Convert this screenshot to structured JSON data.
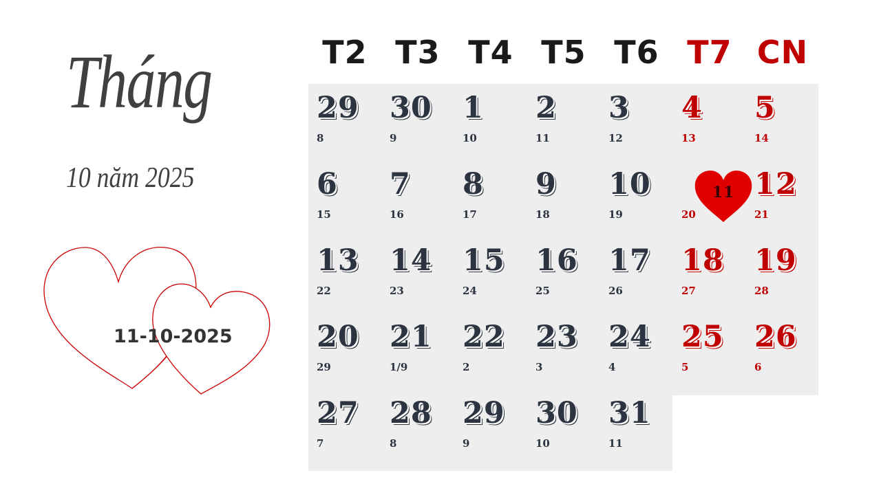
{
  "title": {
    "month_word": "Tháng",
    "month_year": "10 năm 2025"
  },
  "badge": {
    "date": "11-10-2025"
  },
  "weekdays": [
    "T2",
    "T3",
    "T4",
    "T5",
    "T6",
    "T7",
    "CN"
  ],
  "colors": {
    "accent": "#c00000",
    "text": "#2b3440",
    "cell_bg": "#eeeeee"
  },
  "days": [
    {
      "solar": "29",
      "lunar": "8"
    },
    {
      "solar": "30",
      "lunar": "9"
    },
    {
      "solar": "1",
      "lunar": "10"
    },
    {
      "solar": "2",
      "lunar": "11"
    },
    {
      "solar": "3",
      "lunar": "12"
    },
    {
      "solar": "4",
      "lunar": "13"
    },
    {
      "solar": "5",
      "lunar": "14"
    },
    {
      "solar": "6",
      "lunar": "15"
    },
    {
      "solar": "7",
      "lunar": "16"
    },
    {
      "solar": "8",
      "lunar": "17"
    },
    {
      "solar": "9",
      "lunar": "18"
    },
    {
      "solar": "10",
      "lunar": "19"
    },
    {
      "solar": "11",
      "lunar": "20",
      "highlight": "heart"
    },
    {
      "solar": "12",
      "lunar": "21"
    },
    {
      "solar": "13",
      "lunar": "22"
    },
    {
      "solar": "14",
      "lunar": "23"
    },
    {
      "solar": "15",
      "lunar": "24"
    },
    {
      "solar": "16",
      "lunar": "25"
    },
    {
      "solar": "17",
      "lunar": "26"
    },
    {
      "solar": "18",
      "lunar": "27"
    },
    {
      "solar": "19",
      "lunar": "28"
    },
    {
      "solar": "20",
      "lunar": "29"
    },
    {
      "solar": "21",
      "lunar": "1/9"
    },
    {
      "solar": "22",
      "lunar": "2"
    },
    {
      "solar": "23",
      "lunar": "3"
    },
    {
      "solar": "24",
      "lunar": "4"
    },
    {
      "solar": "25",
      "lunar": "5"
    },
    {
      "solar": "26",
      "lunar": "6"
    },
    {
      "solar": "27",
      "lunar": "7"
    },
    {
      "solar": "28",
      "lunar": "8"
    },
    {
      "solar": "29",
      "lunar": "9"
    },
    {
      "solar": "30",
      "lunar": "10"
    },
    {
      "solar": "31",
      "lunar": "11"
    }
  ]
}
